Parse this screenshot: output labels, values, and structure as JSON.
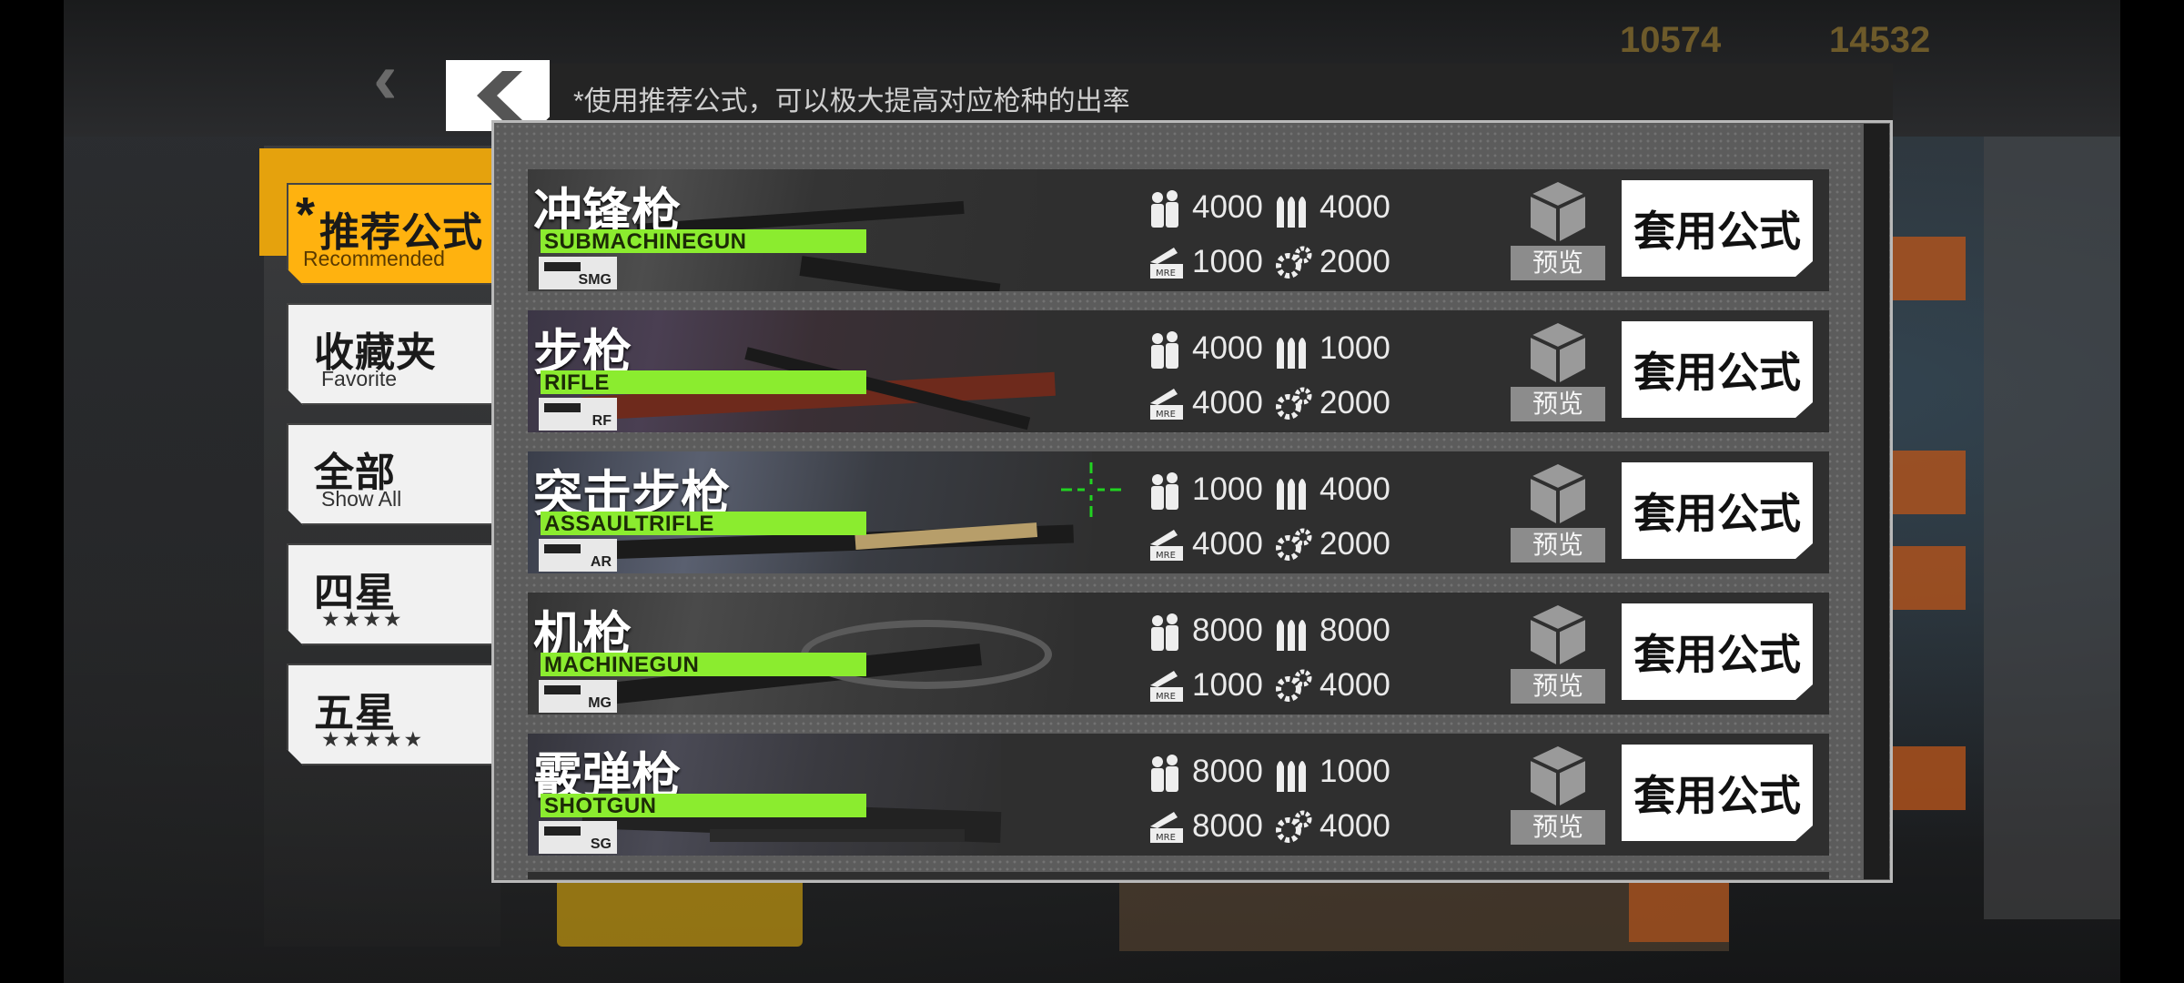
{
  "background": {
    "back_glyph": "‹",
    "resource_1": "10574",
    "resource_2": "14532"
  },
  "dialog": {
    "hint": "*使用推荐公式，可以极大提高对应枪种的出率",
    "back_icon": "chevron-left-icon"
  },
  "tabs": [
    {
      "cn": "推荐公式",
      "en": "Recommended",
      "star": "*",
      "active": true
    },
    {
      "cn": "收藏夹",
      "en": "Favorite",
      "active": false
    },
    {
      "cn": "全部",
      "en": "Show All",
      "active": false
    },
    {
      "cn": "四星",
      "en": "★★★★",
      "active": false
    },
    {
      "cn": "五星",
      "en": "★★★★★",
      "active": false
    }
  ],
  "resource_icons": [
    "manpower-icon",
    "ammo-icon",
    "rations-icon",
    "parts-icon"
  ],
  "rows": [
    {
      "cn": "冲锋枪",
      "en": "SUBMACHINEGUN",
      "type": "SMG",
      "manpower": "4000",
      "ammo": "4000",
      "rations": "1000",
      "parts": "2000",
      "preview": "预览",
      "apply": "套用公式"
    },
    {
      "cn": "步枪",
      "en": "RIFLE",
      "type": "RF",
      "manpower": "4000",
      "ammo": "1000",
      "rations": "4000",
      "parts": "2000",
      "preview": "预览",
      "apply": "套用公式"
    },
    {
      "cn": "突击步枪",
      "en": "ASSAULTRIFLE",
      "type": "AR",
      "manpower": "1000",
      "ammo": "4000",
      "rations": "4000",
      "parts": "2000",
      "preview": "预览",
      "apply": "套用公式"
    },
    {
      "cn": "机枪",
      "en": "MACHINEGUN",
      "type": "MG",
      "manpower": "8000",
      "ammo": "8000",
      "rations": "1000",
      "parts": "4000",
      "preview": "预览",
      "apply": "套用公式"
    },
    {
      "cn": "霰弹枪",
      "en": "SHOTGUN",
      "type": "SG",
      "manpower": "8000",
      "ammo": "1000",
      "rations": "8000",
      "parts": "4000",
      "preview": "预览",
      "apply": "套用公式"
    }
  ],
  "colors": {
    "accent_yellow": "#ffb20f",
    "label_green": "#8bec2f",
    "crosshair_green": "#21d321"
  }
}
